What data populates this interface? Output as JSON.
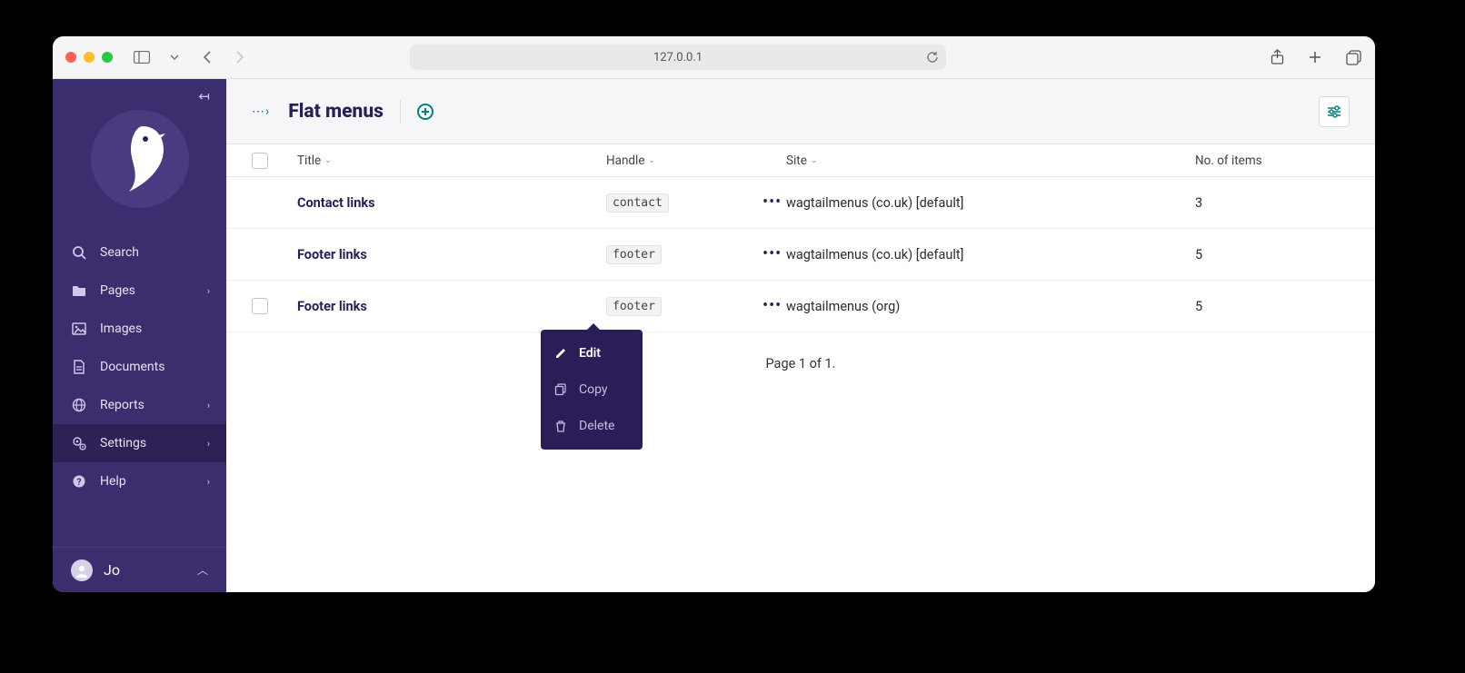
{
  "browser": {
    "url": "127.0.0.1"
  },
  "sidebar": {
    "items": [
      {
        "label": "Search"
      },
      {
        "label": "Pages"
      },
      {
        "label": "Images"
      },
      {
        "label": "Documents"
      },
      {
        "label": "Reports"
      },
      {
        "label": "Settings"
      },
      {
        "label": "Help"
      }
    ],
    "account_name": "Jo"
  },
  "header": {
    "title": "Flat menus",
    "breadcrumb_dots": "⋯›"
  },
  "table": {
    "columns": {
      "title": "Title",
      "handle": "Handle",
      "site": "Site",
      "count": "No. of items"
    },
    "rows": [
      {
        "title": "Contact links",
        "handle": "contact",
        "site": "wagtailmenus (co.uk) [default]",
        "count": "3"
      },
      {
        "title": "Footer links",
        "handle": "footer",
        "site": "wagtailmenus (co.uk) [default]",
        "count": "5"
      },
      {
        "title": "Footer links",
        "handle": "footer",
        "site": "wagtailmenus (org)",
        "count": "5"
      }
    ]
  },
  "popover": {
    "items": [
      {
        "label": "Edit"
      },
      {
        "label": "Copy"
      },
      {
        "label": "Delete"
      }
    ]
  },
  "pagination": {
    "text": "Page 1 of 1."
  }
}
